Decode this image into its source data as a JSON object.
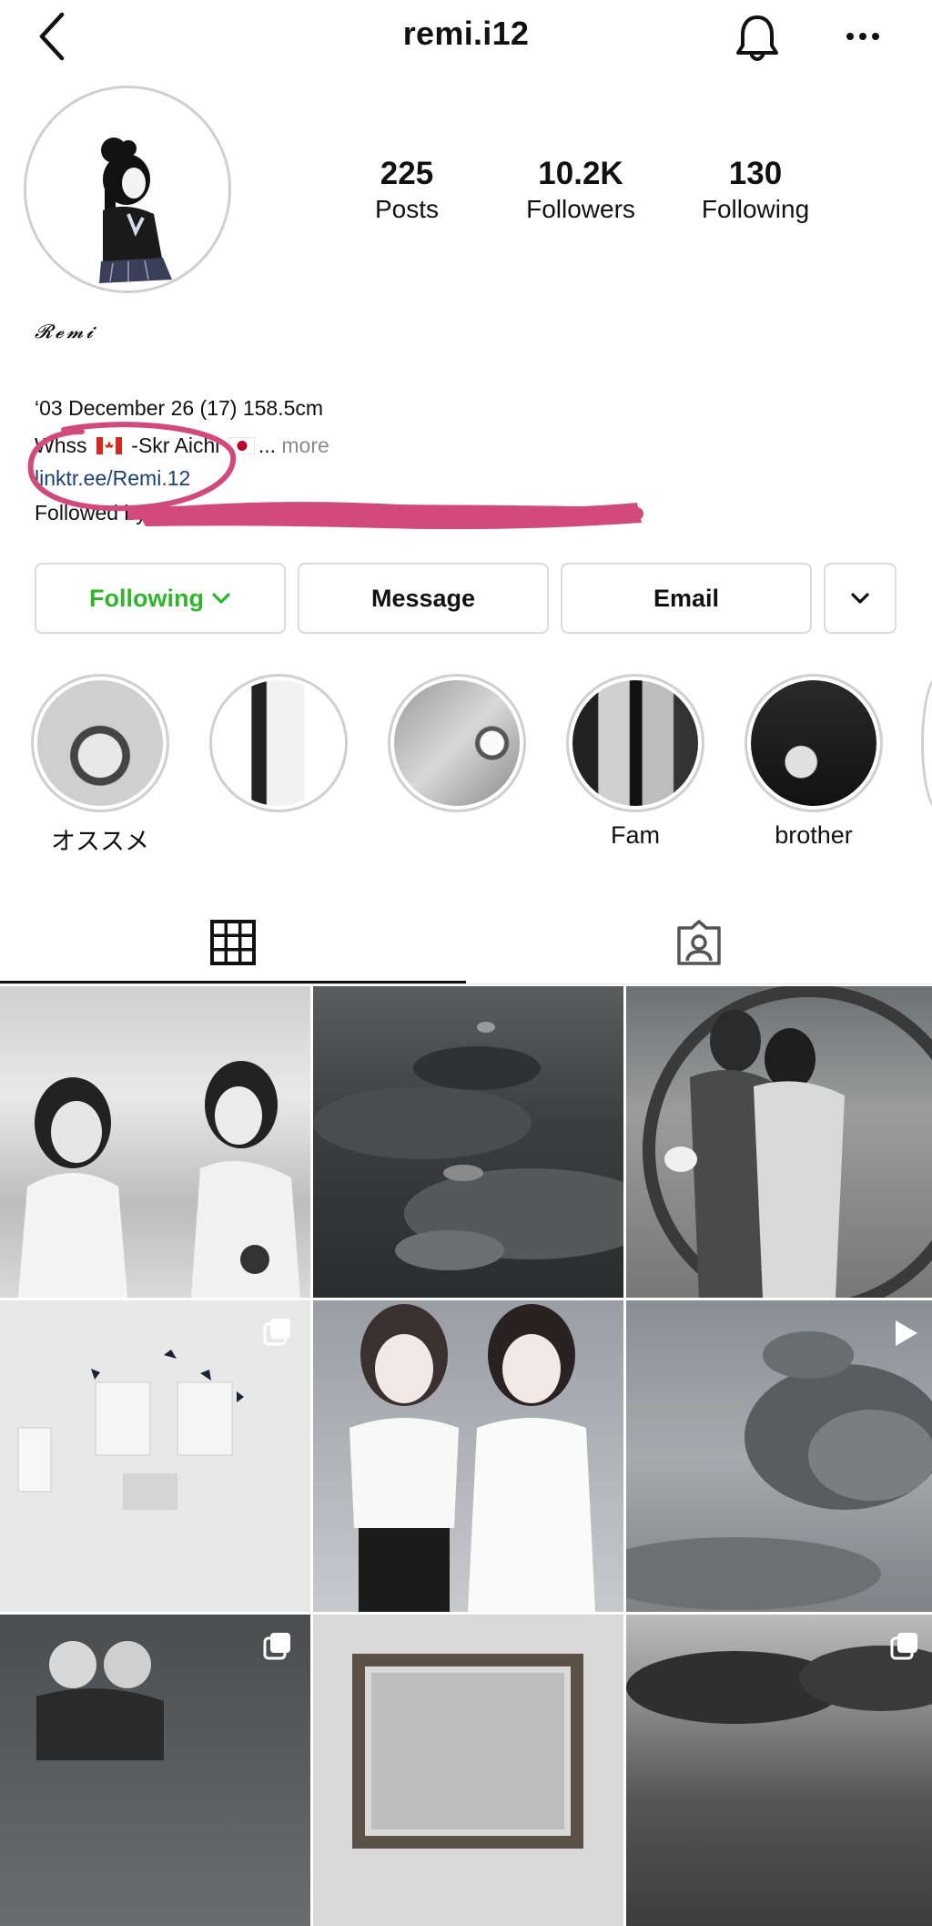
{
  "header": {
    "username": "remi.i12"
  },
  "profile": {
    "stats": [
      {
        "value": "225",
        "label": "Posts"
      },
      {
        "value": "10.2K",
        "label": "Followers"
      },
      {
        "value": "130",
        "label": "Following"
      }
    ],
    "display_name": "𝓡𝓮𝓶𝓲",
    "bio_line1": "‘03 December 26 (17) 158.5cm",
    "bio_line2_a": "Whss",
    "bio_line2_b": "-Skr Aichi",
    "bio_line2_ellipsis": "...",
    "bio_more": "more",
    "link": "linktr.ee/Remi.12",
    "followed_by": "Followed by"
  },
  "actions": {
    "following_label": "Following",
    "message_label": "Message",
    "email_label": "Email"
  },
  "highlights": [
    {
      "label": "オススメ"
    },
    {
      "label": ""
    },
    {
      "label": ""
    },
    {
      "label": "Fam"
    },
    {
      "label": "brother"
    }
  ],
  "tabs": [
    {
      "icon": "grid-icon",
      "active": true
    },
    {
      "icon": "tagged-icon",
      "active": false
    }
  ],
  "posts": [
    {
      "type": "photo"
    },
    {
      "type": "photo"
    },
    {
      "type": "photo"
    },
    {
      "type": "carousel"
    },
    {
      "type": "photo"
    },
    {
      "type": "video"
    },
    {
      "type": "carousel"
    },
    {
      "type": "photo"
    },
    {
      "type": "carousel"
    }
  ],
  "colors": {
    "following_green": "#2fb52b",
    "link_blue": "#1d3f76",
    "annotation_pink": "#d24a7c",
    "border_gray": "#dbdbdb"
  }
}
